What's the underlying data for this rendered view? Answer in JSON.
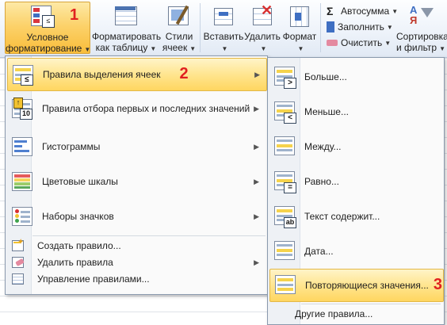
{
  "ribbon": {
    "cond_format": {
      "line1": "Условное",
      "line2": "форматирование",
      "step": "1"
    },
    "format_table": {
      "line1": "Форматировать",
      "line2": "как таблицу"
    },
    "styles": {
      "line1": "Стили",
      "line2": "ячеек"
    },
    "insert": {
      "label": "Вставить"
    },
    "delete": {
      "label": "Удалить"
    },
    "format": {
      "label": "Формат"
    },
    "autosum": {
      "label": "Автосумма"
    },
    "fill": {
      "label": "Заполнить"
    },
    "clear": {
      "label": "Очистить"
    },
    "sort": {
      "line1": "Сортировка",
      "line2": "и фильтр"
    }
  },
  "menu": {
    "items": [
      {
        "label": "Правила выделения ячеек",
        "step": "2"
      },
      {
        "label": "Правила отбора первых и последних значений"
      },
      {
        "label": "Гистограммы"
      },
      {
        "label": "Цветовые шкалы"
      },
      {
        "label": "Наборы значков"
      }
    ],
    "small_items": [
      {
        "label": "Создать правило..."
      },
      {
        "label": "Удалить правила"
      },
      {
        "label": "Управление правилами..."
      }
    ]
  },
  "submenu": {
    "items": [
      {
        "label": "Больше..."
      },
      {
        "label": "Меньше..."
      },
      {
        "label": "Между..."
      },
      {
        "label": "Равно..."
      },
      {
        "label": "Текст содержит..."
      },
      {
        "label": "Дата..."
      },
      {
        "label": "Повторяющиеся значения...",
        "step": "3"
      }
    ],
    "other_rules": "Другие правила..."
  },
  "colors": {
    "highlight": "#ffd660",
    "step_red": "#e02020"
  }
}
